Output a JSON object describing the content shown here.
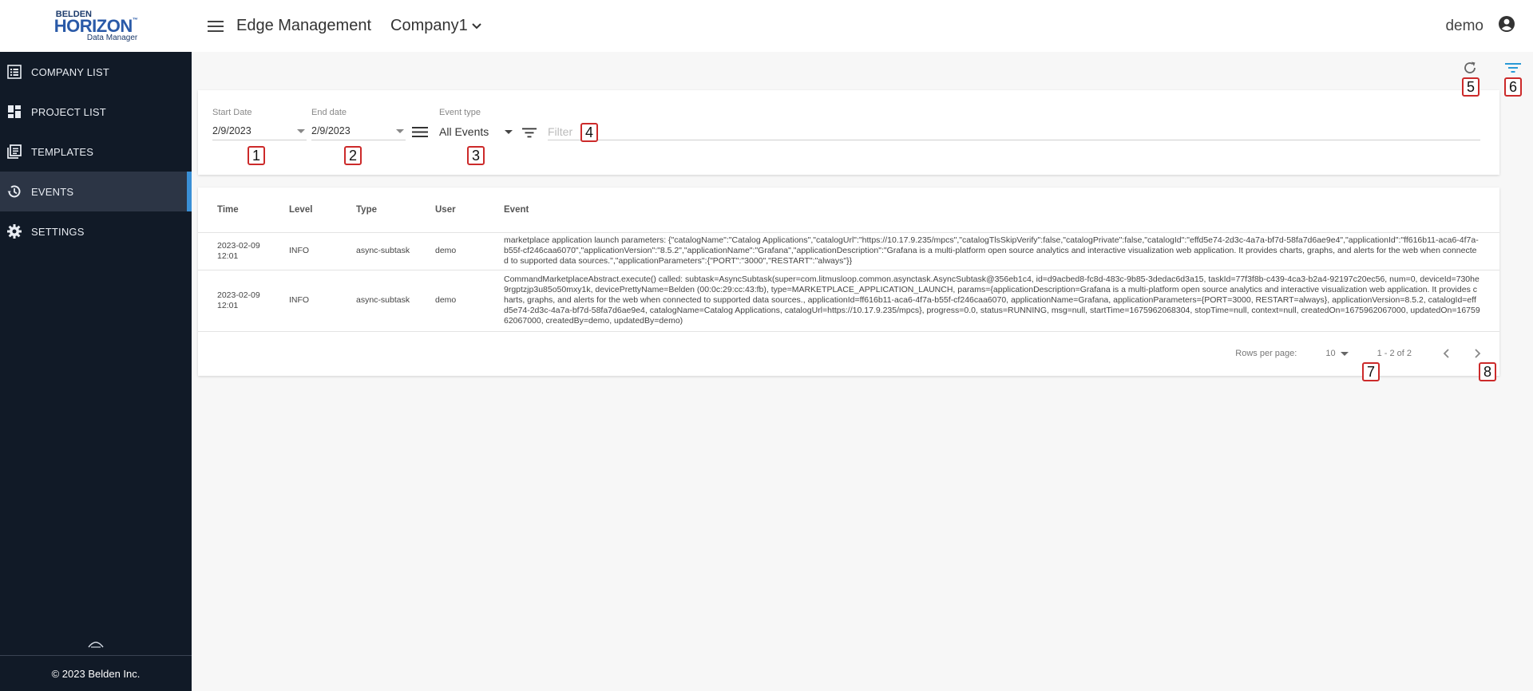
{
  "brand": {
    "logo_top": "BELDEN",
    "logo_main": "HORIZON",
    "logo_tm": "™",
    "logo_sub": "Data Manager"
  },
  "sidebar": {
    "items": [
      {
        "label": "COMPANY LIST",
        "icon": "list-icon"
      },
      {
        "label": "PROJECT LIST",
        "icon": "dashboard-icon"
      },
      {
        "label": "TEMPLATES",
        "icon": "library-books-icon"
      },
      {
        "label": "EVENTS",
        "icon": "history-icon",
        "active": true
      },
      {
        "label": "SETTINGS",
        "icon": "gear-icon"
      }
    ],
    "footer": "© 2023 Belden Inc."
  },
  "header": {
    "title": "Edge Management",
    "company": "Company1",
    "user": "demo"
  },
  "filters": {
    "start_date_label": "Start Date",
    "start_date_value": "2/9/2023",
    "end_date_label": "End date",
    "end_date_value": "2/9/2023",
    "event_type_label": "Event type",
    "event_type_value": "All Events",
    "filter_placeholder": "Filter"
  },
  "table": {
    "columns": [
      "Time",
      "Level",
      "Type",
      "User",
      "Event"
    ],
    "rows": [
      {
        "time": "2023-02-09 12:01",
        "level": "INFO",
        "type": "async-subtask",
        "user": "demo",
        "event": "marketplace application launch parameters: {\"catalogName\":\"Catalog Applications\",\"catalogUrl\":\"https://10.17.9.235/mpcs\",\"catalogTlsSkipVerify\":false,\"catalogPrivate\":false,\"catalogId\":\"effd5e74-2d3c-4a7a-bf7d-58fa7d6ae9e4\",\"applicationId\":\"ff616b11-aca6-4f7a-b55f-cf246caa6070\",\"applicationVersion\":\"8.5.2\",\"applicationName\":\"Grafana\",\"applicationDescription\":\"Grafana is a multi-platform open source analytics and interactive visualization web application. It provides charts, graphs, and alerts for the web when connected to supported data sources.\",\"applicationParameters\":{\"PORT\":\"3000\",\"RESTART\":\"always\"}}"
      },
      {
        "time": "2023-02-09 12:01",
        "level": "INFO",
        "type": "async-subtask",
        "user": "demo",
        "event": "CommandMarketplaceAbstract.execute() called: subtask=AsyncSubtask(super=com.litmusloop.common.asynctask.AsyncSubtask@356eb1c4, id=d9acbed8-fc8d-483c-9b85-3dedac6d3a15, taskId=77f3f8b-c439-4ca3-b2a4-92197c20ec56, num=0, deviceId=730he9rgptzjp3u85o50mxy1k, devicePrettyName=Belden (00:0c:29:cc:43:fb), type=MARKETPLACE_APPLICATION_LAUNCH, params={applicationDescription=Grafana is a multi-platform open source analytics and interactive visualization web application. It provides charts, graphs, and alerts for the web when connected to supported data sources., applicationId=ff616b11-aca6-4f7a-b55f-cf246caa6070, applicationName=Grafana, applicationParameters={PORT=3000, RESTART=always}, applicationVersion=8.5.2, catalogId=effd5e74-2d3c-4a7a-bf7d-58fa7d6ae9e4, catalogName=Catalog Applications, catalogUrl=https://10.17.9.235/mpcs}, progress=0.0, status=RUNNING, msg=null, startTime=1675962068304, stopTime=null, context=null, createdOn=1675962067000, updatedOn=1675962067000, createdBy=demo, updatedBy=demo)"
      }
    ]
  },
  "pagination": {
    "rows_per_page_label": "Rows per page:",
    "rows_per_page_value": "10",
    "range": "1 - 2 of 2"
  },
  "annotations": [
    "1",
    "2",
    "3",
    "4",
    "5",
    "6",
    "7",
    "8"
  ],
  "colors": {
    "sidebar_bg": "#111a27",
    "active_item_bg": "#2c3545",
    "active_accent": "#3a8fd6",
    "filter_icon": "#2a9ad6",
    "badge_border": "#cc2a2a"
  }
}
